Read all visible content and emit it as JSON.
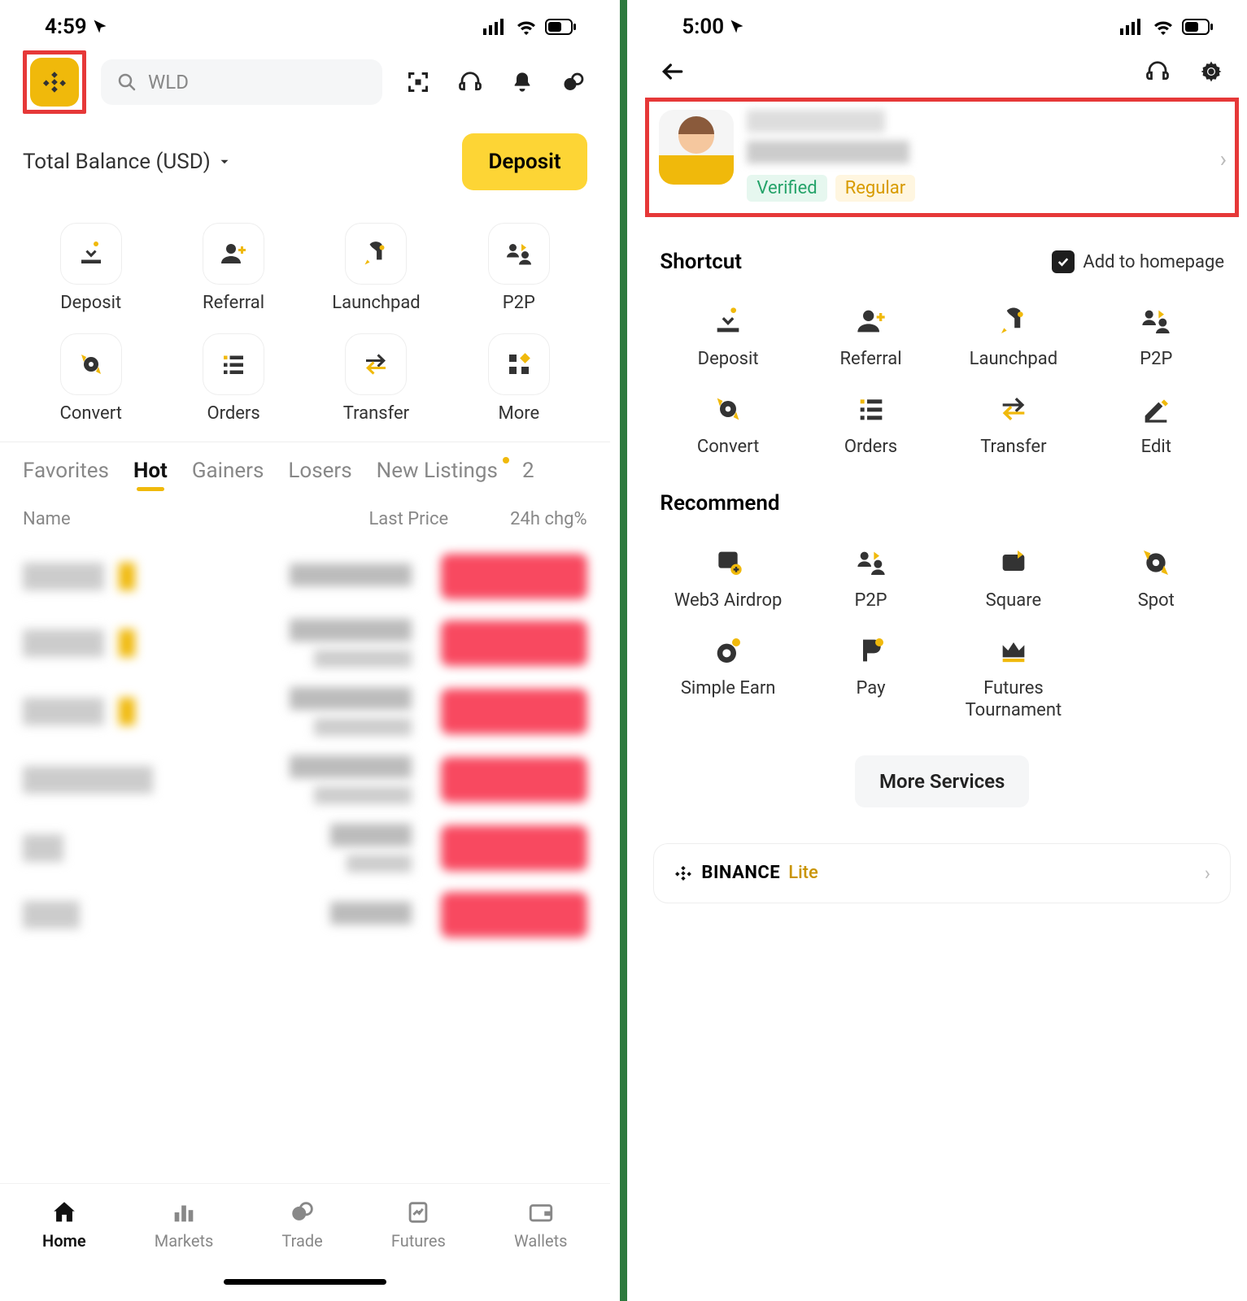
{
  "left": {
    "status_time": "4:59",
    "search_placeholder": "WLD",
    "balance_label": "Total Balance (USD)",
    "deposit_btn": "Deposit",
    "shortcuts": [
      {
        "label": "Deposit"
      },
      {
        "label": "Referral"
      },
      {
        "label": "Launchpad"
      },
      {
        "label": "P2P"
      },
      {
        "label": "Convert"
      },
      {
        "label": "Orders"
      },
      {
        "label": "Transfer"
      },
      {
        "label": "More"
      }
    ],
    "tabs": [
      "Favorites",
      "Hot",
      "Gainers",
      "Losers",
      "New Listings",
      "2"
    ],
    "active_tab_index": 1,
    "list_headers": {
      "name": "Name",
      "last": "Last Price",
      "chg": "24h chg%"
    },
    "nav": [
      "Home",
      "Markets",
      "Trade",
      "Futures",
      "Wallets"
    ],
    "active_nav_index": 0
  },
  "right": {
    "status_time": "5:00",
    "profile": {
      "badge1": "Verified",
      "badge2": "Regular"
    },
    "shortcut_title": "Shortcut",
    "add_homepage": "Add to homepage",
    "add_homepage_checked": true,
    "shortcuts": [
      {
        "label": "Deposit"
      },
      {
        "label": "Referral"
      },
      {
        "label": "Launchpad"
      },
      {
        "label": "P2P"
      },
      {
        "label": "Convert"
      },
      {
        "label": "Orders"
      },
      {
        "label": "Transfer"
      },
      {
        "label": "Edit"
      }
    ],
    "recommend_title": "Recommend",
    "recommend": [
      {
        "label": "Web3 Airdrop"
      },
      {
        "label": "P2P"
      },
      {
        "label": "Square"
      },
      {
        "label": "Spot"
      },
      {
        "label": "Simple Earn"
      },
      {
        "label": "Pay"
      },
      {
        "label": "Futures Tournament"
      }
    ],
    "more_services": "More Services",
    "lite_brand": "BINANCE",
    "lite_word": "Lite"
  }
}
